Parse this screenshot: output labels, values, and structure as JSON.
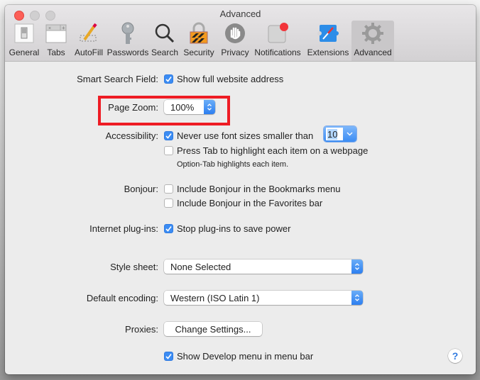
{
  "window": {
    "title": "Advanced",
    "toolbar_tabs": [
      {
        "label": "General",
        "icon": "general-switch-icon"
      },
      {
        "label": "Tabs",
        "icon": "tabs-icon"
      },
      {
        "label": "AutoFill",
        "icon": "pencil-icon"
      },
      {
        "label": "Passwords",
        "icon": "key-icon"
      },
      {
        "label": "Search",
        "icon": "magnifier-icon"
      },
      {
        "label": "Security",
        "icon": "padlock-icon"
      },
      {
        "label": "Privacy",
        "icon": "hand-icon"
      },
      {
        "label": "Notifications",
        "icon": "notification-badge-icon"
      },
      {
        "label": "Extensions",
        "icon": "compass-puzzle-icon"
      },
      {
        "label": "Advanced",
        "icon": "gear-icon",
        "selected": true
      }
    ]
  },
  "settings": {
    "smart_search": {
      "label": "Smart Search Field:",
      "option": "Show full website address",
      "checked": true
    },
    "page_zoom": {
      "label": "Page Zoom:",
      "value": "100%"
    },
    "accessibility": {
      "label": "Accessibility:",
      "font_option": "Never use font sizes smaller than",
      "font_checked": true,
      "font_size": "10",
      "tab_option": "Press Tab to highlight each item on a webpage",
      "tab_checked": false,
      "tab_hint": "Option-Tab highlights each item."
    },
    "bonjour": {
      "label": "Bonjour:",
      "bookmarks_option": "Include Bonjour in the Bookmarks menu",
      "bookmarks_checked": false,
      "favorites_option": "Include Bonjour in the Favorites bar",
      "favorites_checked": false
    },
    "plugins": {
      "label": "Internet plug-ins:",
      "option": "Stop plug-ins to save power",
      "checked": true
    },
    "style_sheet": {
      "label": "Style sheet:",
      "value": "None Selected"
    },
    "encoding": {
      "label": "Default encoding:",
      "value": "Western (ISO Latin 1)"
    },
    "proxies": {
      "label": "Proxies:",
      "button": "Change Settings..."
    },
    "develop": {
      "option": "Show Develop menu in menu bar",
      "checked": true
    },
    "help": "?"
  },
  "colors": {
    "accent": "#3b8cf3",
    "annotation_red": "#ee1c24",
    "close_button": "#fc5f57"
  }
}
